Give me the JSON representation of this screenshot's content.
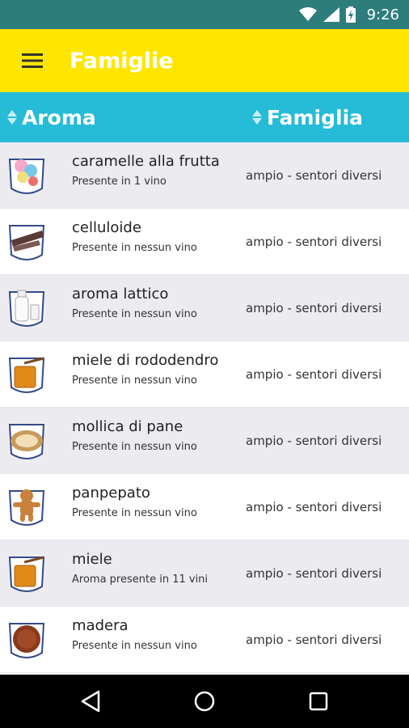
{
  "status_bar": {
    "time": "9:26",
    "icons": [
      "wifi-icon",
      "signal-icon",
      "battery-charging-icon"
    ],
    "color": "#2e7d7d"
  },
  "app_bar": {
    "title": "Famiglie",
    "menu_icon": "hamburger-menu-icon",
    "color": "#ffe600"
  },
  "columns": {
    "aroma": "Aroma",
    "famiglia": "Famiglia",
    "color": "#26bcd7"
  },
  "rows": [
    {
      "name": "caramelle alla frutta",
      "subtitle": "Presente in 1 vino",
      "family": "ampio - sentori diversi",
      "icon": "fruit-candies-icon"
    },
    {
      "name": "celluloide",
      "subtitle": "Presente in nessun vino",
      "family": "ampio - sentori diversi",
      "icon": "celluloid-film-icon"
    },
    {
      "name": "aroma lattico",
      "subtitle": "Presente in nessun vino",
      "family": "ampio - sentori diversi",
      "icon": "milk-bottle-icon"
    },
    {
      "name": "miele di rododendro",
      "subtitle": "Presente in nessun vino",
      "family": "ampio - sentori diversi",
      "icon": "honey-jar-icon"
    },
    {
      "name": "mollica di pane",
      "subtitle": "Presente in nessun vino",
      "family": "ampio - sentori diversi",
      "icon": "bread-icon"
    },
    {
      "name": "panpepato",
      "subtitle": "Presente in nessun vino",
      "family": "ampio - sentori diversi",
      "icon": "gingerbread-icon"
    },
    {
      "name": "miele",
      "subtitle": "Aroma presente in 11 vini",
      "family": "ampio - sentori diversi",
      "icon": "honey-jar-icon"
    },
    {
      "name": "madera",
      "subtitle": "Presente in nessun vino",
      "family": "ampio - sentori diversi",
      "icon": "madeira-wine-icon"
    }
  ],
  "nav_bar": {
    "back": "back-icon",
    "home": "home-icon",
    "recents": "recents-icon"
  }
}
